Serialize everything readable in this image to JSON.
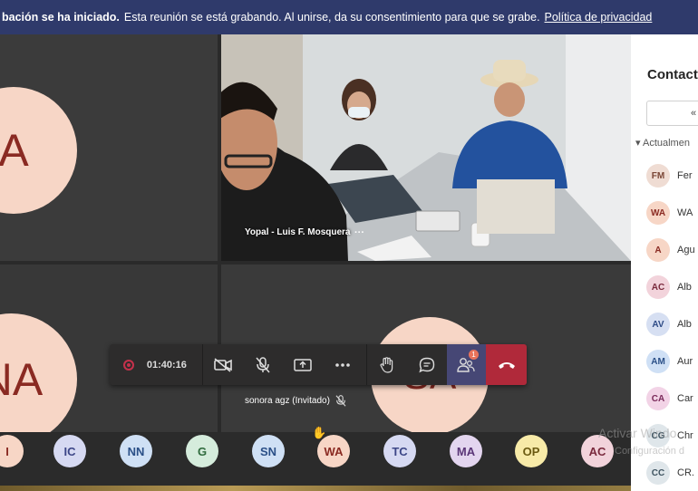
{
  "banner": {
    "bold": "bación se ha iniciado.",
    "text": "Esta reunión se está grabando. Al unirse, da su consentimiento para que se grabe.",
    "link": "Política de privacidad"
  },
  "tiles": {
    "top_left_initials": "A",
    "bottom_left_initials": "NA",
    "bottom_right_initials": "SA",
    "video_name": "Yopal - Luis F. Mosquera",
    "video_more": "···"
  },
  "controls": {
    "timer": "01:40:16",
    "people_badge": "1"
  },
  "guest_label": "sonora agz (Invitado)",
  "bottom_avatars": [
    {
      "initials": "I",
      "bg": "#f7d6c6",
      "fg": "#8a2a22"
    },
    {
      "initials": "IC",
      "bg": "#d6d9f2",
      "fg": "#3c4687"
    },
    {
      "initials": "NN",
      "bg": "#cfe0f5",
      "fg": "#2a4f87"
    },
    {
      "initials": "G",
      "bg": "#d5ecdc",
      "fg": "#2f6b3d"
    },
    {
      "initials": "SN",
      "bg": "#cfe0f5",
      "fg": "#2a4f87"
    },
    {
      "initials": "WA",
      "bg": "#f7d6c6",
      "fg": "#8a2a22"
    },
    {
      "initials": "TC",
      "bg": "#d6d9f2",
      "fg": "#3c4687"
    },
    {
      "initials": "MA",
      "bg": "#e3d5ef",
      "fg": "#5a3577"
    },
    {
      "initials": "OP",
      "bg": "#f7eaa8",
      "fg": "#6b5a12"
    },
    {
      "initials": "AC",
      "bg": "#f2d3db",
      "fg": "#7a2a3d"
    }
  ],
  "panel": {
    "title": "Contact",
    "button": "«",
    "section": "Actualmen",
    "items": [
      {
        "initials": "FM",
        "name": "Fer",
        "bg": "#efdcd3",
        "fg": "#7a4636"
      },
      {
        "initials": "WA",
        "name": "WA",
        "bg": "#f7d6c6",
        "fg": "#8a2a22"
      },
      {
        "initials": "A",
        "name": "Agu",
        "bg": "#f7d6c6",
        "fg": "#8a2a22"
      },
      {
        "initials": "AC",
        "name": "Alb",
        "bg": "#f2d3db",
        "fg": "#7a2a3d"
      },
      {
        "initials": "AV",
        "name": "Alb",
        "bg": "#d6dff2",
        "fg": "#2f4c87"
      },
      {
        "initials": "AM",
        "name": "Aur",
        "bg": "#cfe0f5",
        "fg": "#2a4f87"
      },
      {
        "initials": "CA",
        "name": "Car",
        "bg": "#f2d3e6",
        "fg": "#7a2a5a"
      },
      {
        "initials": "CG",
        "name": "Chr",
        "bg": "#dfe6ea",
        "fg": "#3f5461"
      },
      {
        "initials": "CC",
        "name": "CR.",
        "bg": "#dfe6ea",
        "fg": "#3f5461"
      }
    ]
  },
  "watermark": {
    "line1": "Activar Windo",
    "line2": "Configuración d"
  }
}
